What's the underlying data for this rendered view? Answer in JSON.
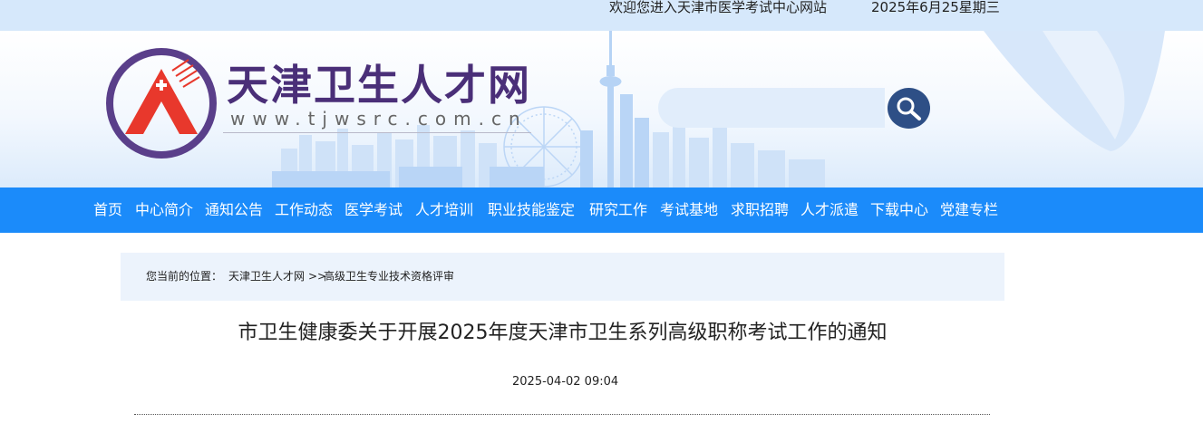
{
  "topbar": {
    "welcome": "欢迎您进入天津市医学考试中心网站",
    "date": "2025年6月25星期三"
  },
  "header": {
    "site_name": "天津卫生人才网",
    "site_url": "www.tjwsrc.com.cn",
    "search_placeholder": "",
    "brand_color": "#4a2f78",
    "emblem_color": "#e8382c",
    "search_button_color": "#2e4f86"
  },
  "nav": {
    "color": "#1b8bfa",
    "items": [
      {
        "label": "首页"
      },
      {
        "label": "中心简介"
      },
      {
        "label": "通知公告"
      },
      {
        "label": "工作动态"
      },
      {
        "label": "医学考试"
      },
      {
        "label": "人才培训"
      },
      {
        "label": "职业技能鉴定"
      },
      {
        "label": "研究工作"
      },
      {
        "label": "考试基地"
      },
      {
        "label": "求职招聘"
      },
      {
        "label": "人才派遣"
      },
      {
        "label": "下载中心"
      },
      {
        "label": "党建专栏"
      }
    ]
  },
  "breadcrumb": {
    "prefix": "您当前的位置：",
    "home": "天津卫生人才网",
    "separator": ">>",
    "current": "高级卫生专业技术资格评审"
  },
  "article": {
    "title": "市卫生健康委关于开展2025年度天津市卫生系列高级职称考试工作的通知",
    "date": "2025-04-02 09:04"
  }
}
